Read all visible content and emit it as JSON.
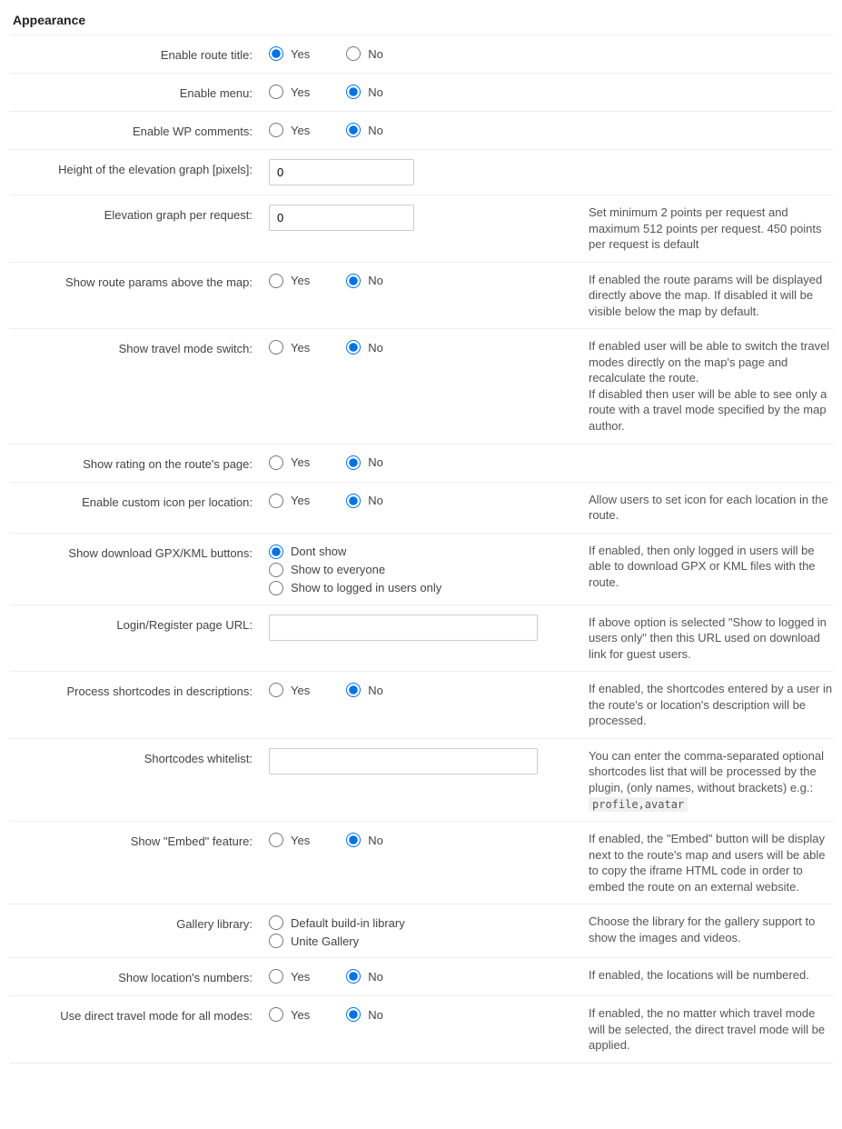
{
  "section_title": "Appearance",
  "yes": "Yes",
  "no": "No",
  "rows": {
    "route_title": {
      "label": "Enable route title:"
    },
    "menu": {
      "label": "Enable menu:"
    },
    "wp_comments": {
      "label": "Enable WP comments:"
    },
    "elev_height": {
      "label": "Height of the elevation graph [pixels]:",
      "value": "0"
    },
    "elev_req": {
      "label": "Elevation graph per request:",
      "value": "0",
      "help": "Set minimum 2 points per request and maximum 512 points per request. 450 points per request is default"
    },
    "route_params": {
      "label": "Show route params above the map:",
      "help": "If enabled the route params will be displayed directly above the map. If disabled it will be visible below the map by default."
    },
    "travel_mode": {
      "label": "Show travel mode switch:",
      "help1": "If enabled user will be able to switch the travel modes directly on the map's page and recalculate the route.",
      "help2": "If disabled then user will be able to see only a route with a travel mode specified by the map author."
    },
    "rating": {
      "label": "Show rating on the route's page:"
    },
    "custom_icon": {
      "label": "Enable custom icon per location:",
      "help": "Allow users to set icon for each location in the route."
    },
    "gpx": {
      "label": "Show download GPX/KML buttons:",
      "opt1": "Dont show",
      "opt2": "Show to everyone",
      "opt3": "Show to logged in users only",
      "help": "If enabled, then only logged in users will be able to download GPX or KML files with the route."
    },
    "login_url": {
      "label": "Login/Register page URL:",
      "value": "",
      "help": "If above option is selected \"Show to logged in users only\" then this URL used on download link for guest users."
    },
    "shortcodes": {
      "label": "Process shortcodes in descriptions:",
      "help": "If enabled, the shortcodes entered by a user in the route's or location's description will be processed."
    },
    "whitelist": {
      "label": "Shortcodes whitelist:",
      "value": "",
      "help": "You can enter the comma-separated optional shortcodes list that will be processed by the plugin, (only names, without brackets) e.g.: ",
      "code": "profile,avatar"
    },
    "embed": {
      "label": "Show \"Embed\" feature:",
      "help": "If enabled, the \"Embed\" button will be display next to the route's map and users will be able to copy the iframe HTML code in order to embed the route on an external website."
    },
    "gallery": {
      "label": "Gallery library:",
      "opt1": "Default build-in library",
      "opt2": "Unite Gallery",
      "help": "Choose the library for the gallery support to show the images and videos."
    },
    "loc_numbers": {
      "label": "Show location's numbers:",
      "help": "If enabled, the locations will be numbered."
    },
    "direct_mode": {
      "label": "Use direct travel mode for all modes:",
      "help": "If enabled, the no matter which travel mode will be selected, the direct travel mode will be applied."
    }
  }
}
